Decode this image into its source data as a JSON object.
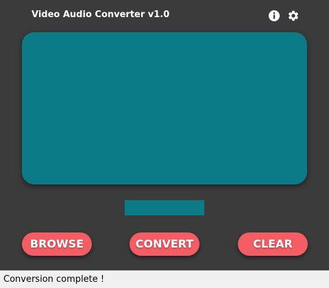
{
  "app": {
    "title": "Video Audio Converter v1.0"
  },
  "icons": {
    "info": "info-icon",
    "settings": "gear-icon"
  },
  "buttons": {
    "browse": "BROWSE",
    "convert": "CONVERT",
    "clear": "CLEAR"
  },
  "status": {
    "text": "Conversion complete !"
  },
  "colors": {
    "background": "#3b3b3b",
    "panel": "#0a7b87",
    "button": "#f35d63",
    "status_bar": "#f0f0f0"
  }
}
